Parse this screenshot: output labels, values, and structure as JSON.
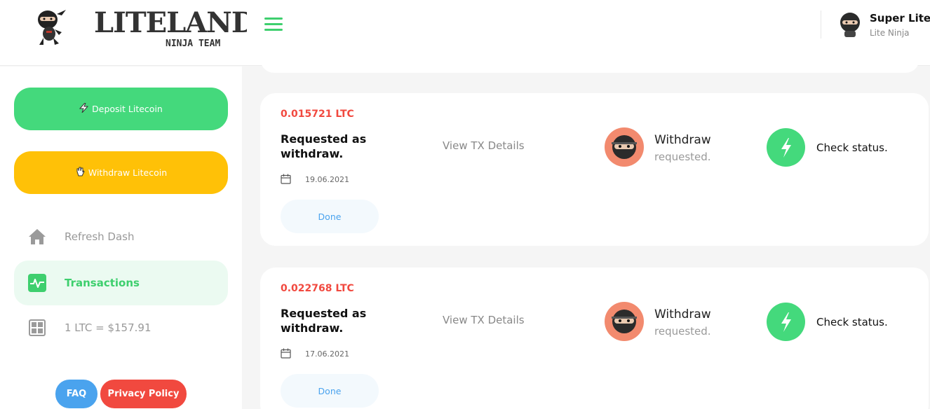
{
  "header": {
    "brand_top": "LITELAND",
    "brand_sub": "NINJA TEAM",
    "user_name": "Super Lite",
    "user_role": "Lite Ninja"
  },
  "sidebar": {
    "deposit_label": "Deposit Litecoin",
    "withdraw_label": "Withdraw Litecoin",
    "nav": {
      "refresh": "Refresh Dash",
      "transactions": "Transactions",
      "rate": "1 LTC = $157.91"
    },
    "faq": "FAQ",
    "privacy": "Privacy Policy"
  },
  "transactions": [
    {
      "amount": "0.015721 LTC",
      "title": "Requested as withdraw.",
      "date": "19.06.2021",
      "status_button": "Done",
      "tx_link": "View TX Details",
      "type": "Withdraw",
      "type_sub": "requested.",
      "check": "Check status."
    },
    {
      "amount": "0.022768 LTC",
      "title": "Requested as withdraw.",
      "date": "17.06.2021",
      "status_button": "Done",
      "tx_link": "View TX Details",
      "type": "Withdraw",
      "type_sub": "requested.",
      "check": "Check status."
    }
  ],
  "colors": {
    "accent_green": "#44d97c",
    "accent_yellow": "#ffc107",
    "accent_red": "#f1493f",
    "accent_blue": "#4aa3ee"
  },
  "icons": {
    "menu": "hamburger-icon",
    "refresh": "home-icon",
    "transactions": "pulse-icon",
    "rate": "grid-icon",
    "deposit": "bolt-icon",
    "withdraw": "hand-icon",
    "date": "calendar-icon",
    "status": "bolt-icon"
  }
}
